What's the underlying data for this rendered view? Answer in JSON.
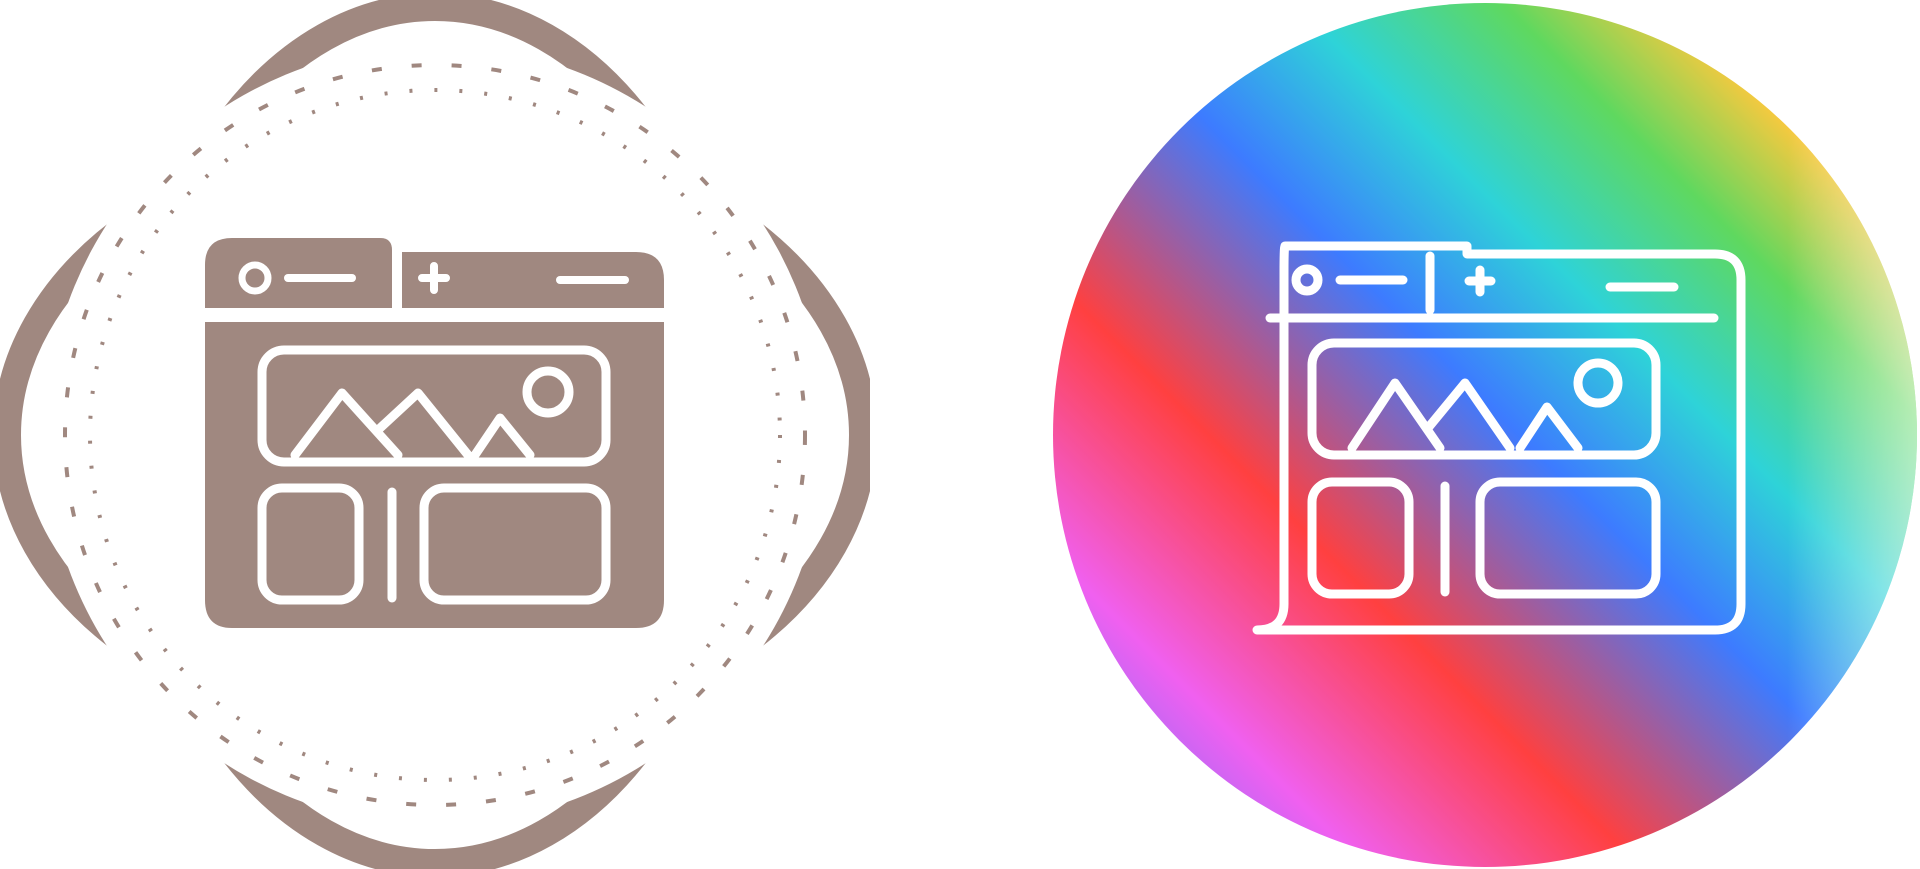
{
  "icons": [
    {
      "name": "web-layout-icon-glyph",
      "style": "glyph",
      "badge_color": "#a08880",
      "foreground_color": "#ffffff"
    },
    {
      "name": "web-layout-icon-gradient",
      "style": "line-gradient",
      "gradient_colors": [
        "#ff3b3b",
        "#ffc83d",
        "#5fd85f",
        "#2ed3d8",
        "#3d7bff",
        "#f060f0",
        "#ff4040",
        "#3d7bff"
      ],
      "foreground_color": "#ffffff"
    }
  ]
}
